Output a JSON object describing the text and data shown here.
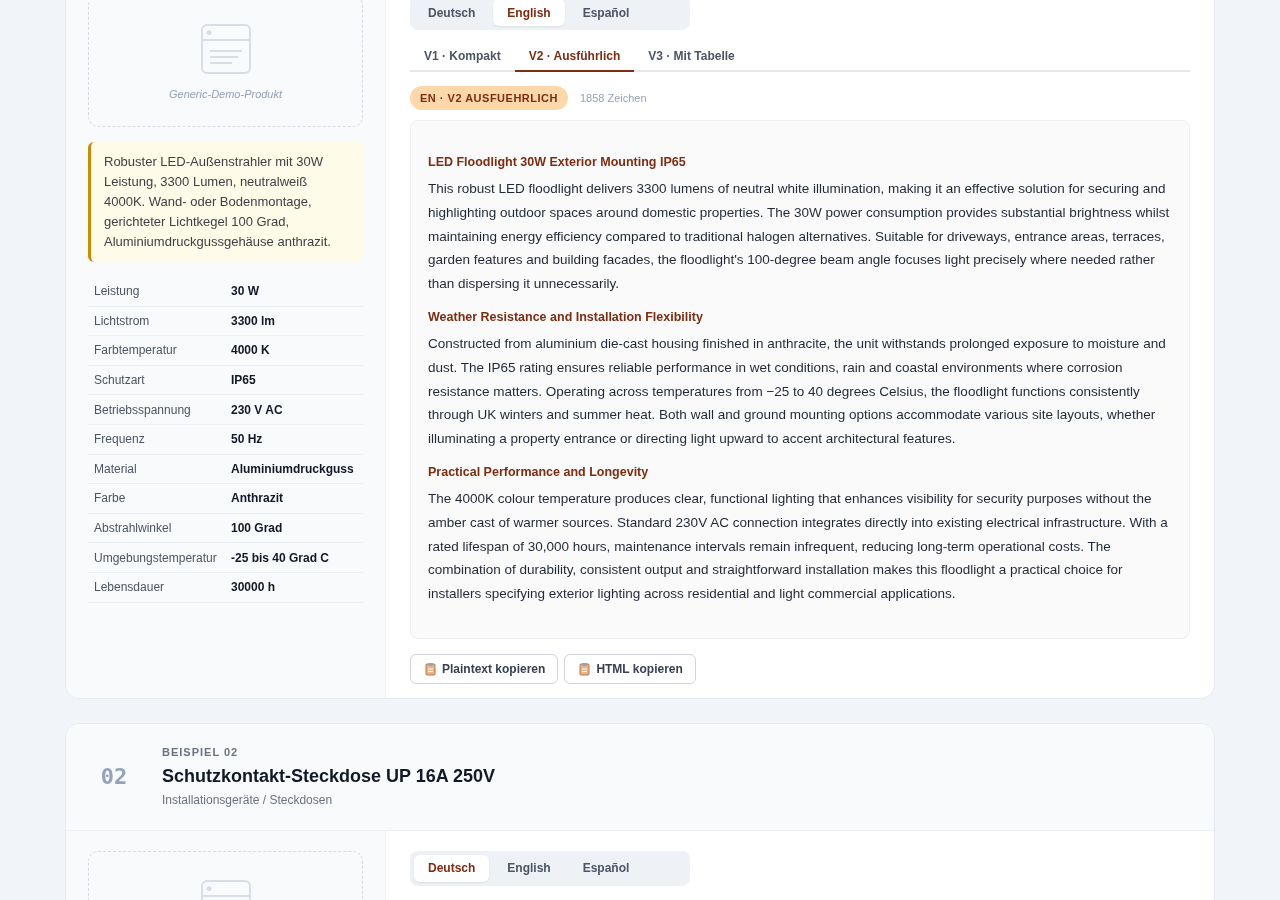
{
  "products": [
    {
      "body": {
        "image_label": "Generic-Demo-Produkt",
        "summary": "Robuster LED-Außenstrahler mit 30W Leistung, 3300 Lumen, neutralweiß 4000K. Wand- oder Bodenmontage, gerichteter Lichtkegel 100 Grad, Aluminiumdruckgussgehäuse anthrazit.",
        "specs": [
          {
            "label": "Leistung",
            "value": "30 W"
          },
          {
            "label": "Lichtstrom",
            "value": "3300 lm"
          },
          {
            "label": "Farbtemperatur",
            "value": "4000 K"
          },
          {
            "label": "Schutzart",
            "value": "IP65"
          },
          {
            "label": "Betriebsspannung",
            "value": "230 V AC"
          },
          {
            "label": "Frequenz",
            "value": "50 Hz"
          },
          {
            "label": "Material",
            "value": "Aluminiumdruckguss"
          },
          {
            "label": "Farbe",
            "value": "Anthrazit"
          },
          {
            "label": "Abstrahlwinkel",
            "value": "100 Grad"
          },
          {
            "label": "Umgebungstemperatur",
            "value": "-25 bis 40 Grad C"
          },
          {
            "label": "Lebensdauer",
            "value": "30000 h"
          }
        ],
        "languages": [
          {
            "label": "Deutsch",
            "selected": false
          },
          {
            "label": "English",
            "selected": true
          },
          {
            "label": "Español",
            "selected": false
          }
        ],
        "versions": [
          {
            "label": "V1 · Kompakt",
            "selected": false
          },
          {
            "label": "V2 · Ausführlich",
            "selected": true
          },
          {
            "label": "V3 · Mit Tabelle",
            "selected": false
          }
        ],
        "badge": "EN · V2 AUSFUEHRLICH",
        "char_count": "1858 Zeichen",
        "content": [
          {
            "kind": "heading",
            "text": "LED Floodlight 30W Exterior Mounting IP65"
          },
          {
            "kind": "paragraph",
            "text": "This robust LED floodlight delivers 3300 lumens of neutral white illumination, making it an effective solution for securing and highlighting outdoor spaces around domestic properties. The 30W power consumption provides substantial brightness whilst maintaining energy efficiency compared to traditional halogen alternatives. Suitable for driveways, entrance areas, terraces, garden features and building facades, the floodlight's 100-degree beam angle focuses light precisely where needed rather than dispersing it unnecessarily."
          },
          {
            "kind": "heading",
            "text": "Weather Resistance and Installation Flexibility"
          },
          {
            "kind": "paragraph",
            "text": "Constructed from aluminium die-cast housing finished in anthracite, the unit withstands prolonged exposure to moisture and dust. The IP65 rating ensures reliable performance in wet conditions, rain and coastal environments where corrosion resistance matters. Operating across temperatures from −25 to 40 degrees Celsius, the floodlight functions consistently through UK winters and summer heat. Both wall and ground mounting options accommodate various site layouts, whether illuminating a property entrance or directing light upward to accent architectural features."
          },
          {
            "kind": "heading",
            "text": "Practical Performance and Longevity"
          },
          {
            "kind": "paragraph",
            "text": "The 4000K colour temperature produces clear, functional lighting that enhances visibility for security purposes without the amber cast of warmer sources. Standard 230V AC connection integrates directly into existing electrical infrastructure. With a rated lifespan of 30,000 hours, maintenance intervals remain infrequent, reducing long-term operational costs. The combination of durability, consistent output and straightforward installation makes this floodlight a practical choice for installers specifying exterior lighting across residential and light commercial applications."
          }
        ],
        "buttons": [
          "Plaintext kopieren",
          "HTML kopieren"
        ]
      }
    },
    {
      "header": {
        "number": "02",
        "eyebrow": "BEISPIEL 02",
        "title": "Schutzkontakt-Steckdose UP 16A 250V",
        "category": "Installationsgeräte / Steckdosen"
      },
      "body": {
        "languages": [
          {
            "label": "Deutsch",
            "selected": true
          },
          {
            "label": "English",
            "selected": false
          },
          {
            "label": "Español",
            "selected": false
          }
        ]
      }
    }
  ]
}
